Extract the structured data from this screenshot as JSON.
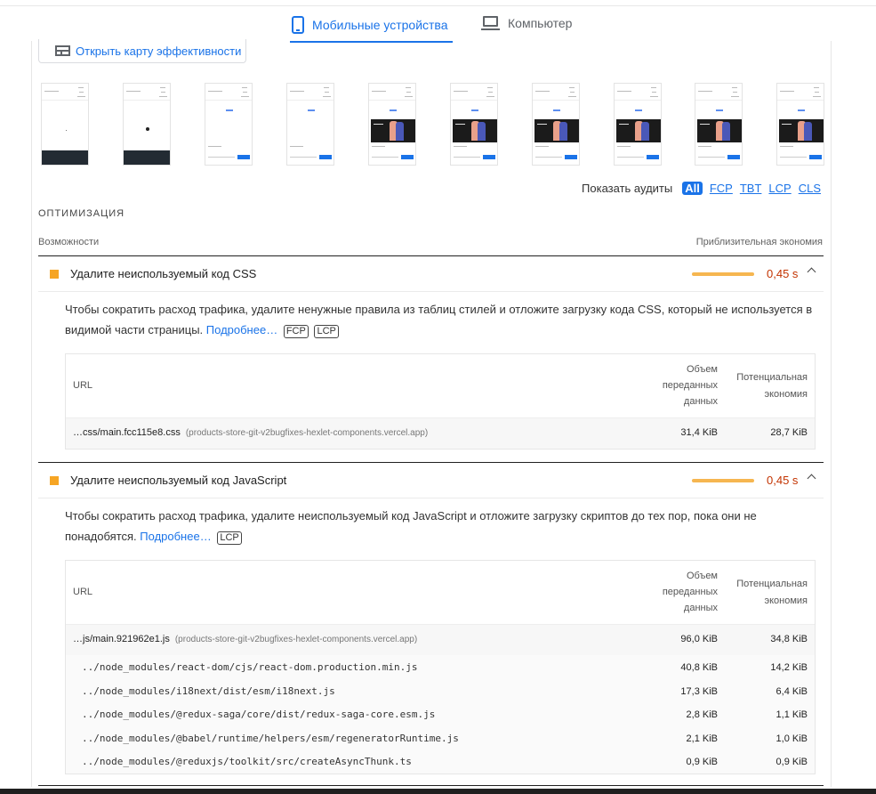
{
  "tabs": {
    "mobile": "Мобильные устройства",
    "desktop": "Компьютер"
  },
  "treemap_button": "Открыть карту эффективности",
  "filmstrip": [
    {
      "frame": "blank-footer"
    },
    {
      "frame": "dot-footer"
    },
    {
      "frame": "skeleton"
    },
    {
      "frame": "skeleton"
    },
    {
      "frame": "full"
    },
    {
      "frame": "full"
    },
    {
      "frame": "full"
    },
    {
      "frame": "full"
    },
    {
      "frame": "full"
    },
    {
      "frame": "full"
    }
  ],
  "audit_filter": {
    "label": "Показать аудиты",
    "chips": [
      "All",
      "FCP",
      "TBT",
      "LCP",
      "CLS"
    ],
    "active": "All"
  },
  "section_title": "ОПТИМИЗАЦИЯ",
  "columns": {
    "left": "Возможности",
    "right": "Приблизительная экономия"
  },
  "audits": [
    {
      "title": "Удалите неиспользуемый код CSS",
      "savings": "0,45 s",
      "desc": "Чтобы сократить расход трафика, удалите ненужные правила из таблиц стилей и отложите загрузку кода CSS, который не используется в видимой части страницы.",
      "learn_more": "Подробнее…",
      "tags": [
        "FCP",
        "LCP"
      ],
      "table": {
        "h_url": "URL",
        "h_size": "Объем переданных данных",
        "h_savings": "Потенциальная экономия",
        "rows": [
          {
            "url": "…css/main.fcc115e8.css",
            "host": "(products-store-git-v2bugfixes-hexlet-components.vercel.app)",
            "size": "31,4 KiB",
            "savings": "28,7 KiB"
          }
        ]
      }
    },
    {
      "title": "Удалите неиспользуемый код JavaScript",
      "savings": "0,45 s",
      "desc": "Чтобы сократить расход трафика, удалите неиспользуемый код JavaScript и отложите загрузку скриптов до тех пор, пока они не понадобятся.",
      "learn_more": "Подробнее…",
      "tags": [
        "LCP"
      ],
      "table": {
        "h_url": "URL",
        "h_size": "Объем переданных данных",
        "h_savings": "Потенциальная экономия",
        "rows": [
          {
            "url": "…js/main.921962e1.js",
            "host": "(products-store-git-v2bugfixes-hexlet-components.vercel.app)",
            "size": "96,0 KiB",
            "savings": "34,8 KiB"
          },
          {
            "url": "../node_modules/react-dom/cjs/react-dom.production.min.js",
            "size": "40,8 KiB",
            "savings": "14,2 KiB"
          },
          {
            "url": "../node_modules/i18next/dist/esm/i18next.js",
            "size": "17,3 KiB",
            "savings": "6,4 KiB"
          },
          {
            "url": "../node_modules/@redux-saga/core/dist/redux-saga-core.esm.js",
            "size": "2,8 KiB",
            "savings": "1,1 KiB"
          },
          {
            "url": "../node_modules/@babel/runtime/helpers/esm/regeneratorRuntime.js",
            "size": "2,1 KiB",
            "savings": "1,0 KiB"
          },
          {
            "url": "../node_modules/@reduxjs/toolkit/src/createAsyncThunk.ts",
            "size": "0,9 KiB",
            "savings": "0,9 KiB"
          }
        ]
      }
    }
  ],
  "colors": {
    "accent": "#1a73e8",
    "warn_square": "#f6a524",
    "savings_text": "#c33300"
  }
}
